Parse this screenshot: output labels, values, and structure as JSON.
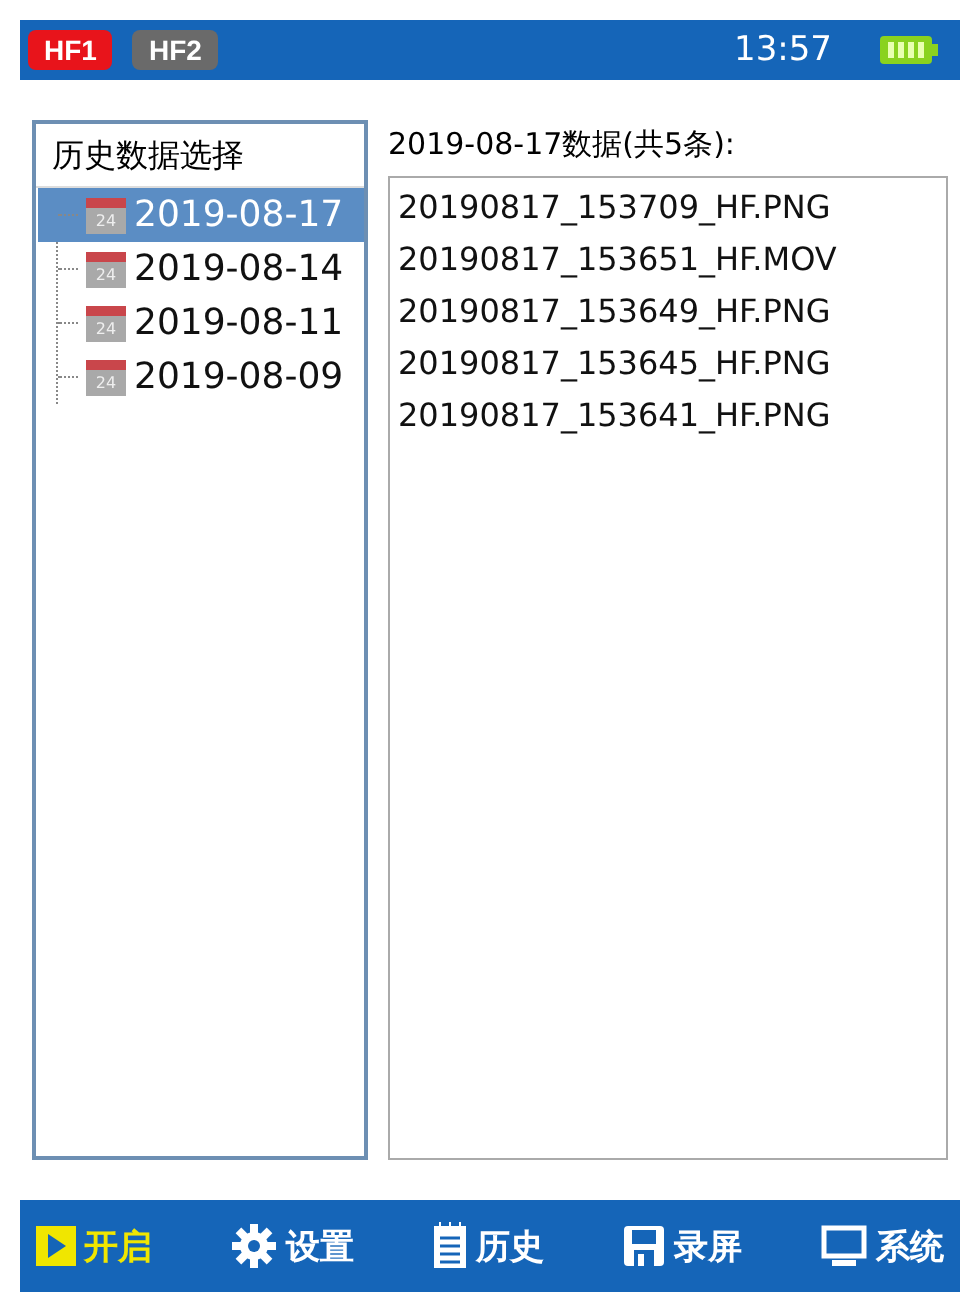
{
  "status_bar": {
    "channels": [
      {
        "label": "HF1",
        "selected": true
      },
      {
        "label": "HF2",
        "selected": false
      }
    ],
    "time": "13:57"
  },
  "history_panel": {
    "title": "历史数据选择",
    "dates": [
      {
        "label": "2019-08-17",
        "icon_label": "24",
        "selected": true
      },
      {
        "label": "2019-08-14",
        "icon_label": "24",
        "selected": false
      },
      {
        "label": "2019-08-11",
        "icon_label": "24",
        "selected": false
      },
      {
        "label": "2019-08-09",
        "icon_label": "24",
        "selected": false
      }
    ]
  },
  "file_panel": {
    "heading": "2019-08-17数据(共5条):",
    "files": [
      "20190817_153709_HF.PNG",
      "20190817_153651_HF.MOV",
      "20190817_153649_HF.PNG",
      "20190817_153645_HF.PNG",
      "20190817_153641_HF.PNG"
    ]
  },
  "toolbar": [
    {
      "kind": "play",
      "label": "开启",
      "selected": true
    },
    {
      "kind": "gear",
      "label": "设置",
      "selected": false
    },
    {
      "kind": "notepad",
      "label": "历史",
      "selected": false
    },
    {
      "kind": "floppy",
      "label": "录屏",
      "selected": false
    },
    {
      "kind": "monitor",
      "label": "系统",
      "selected": false
    }
  ]
}
